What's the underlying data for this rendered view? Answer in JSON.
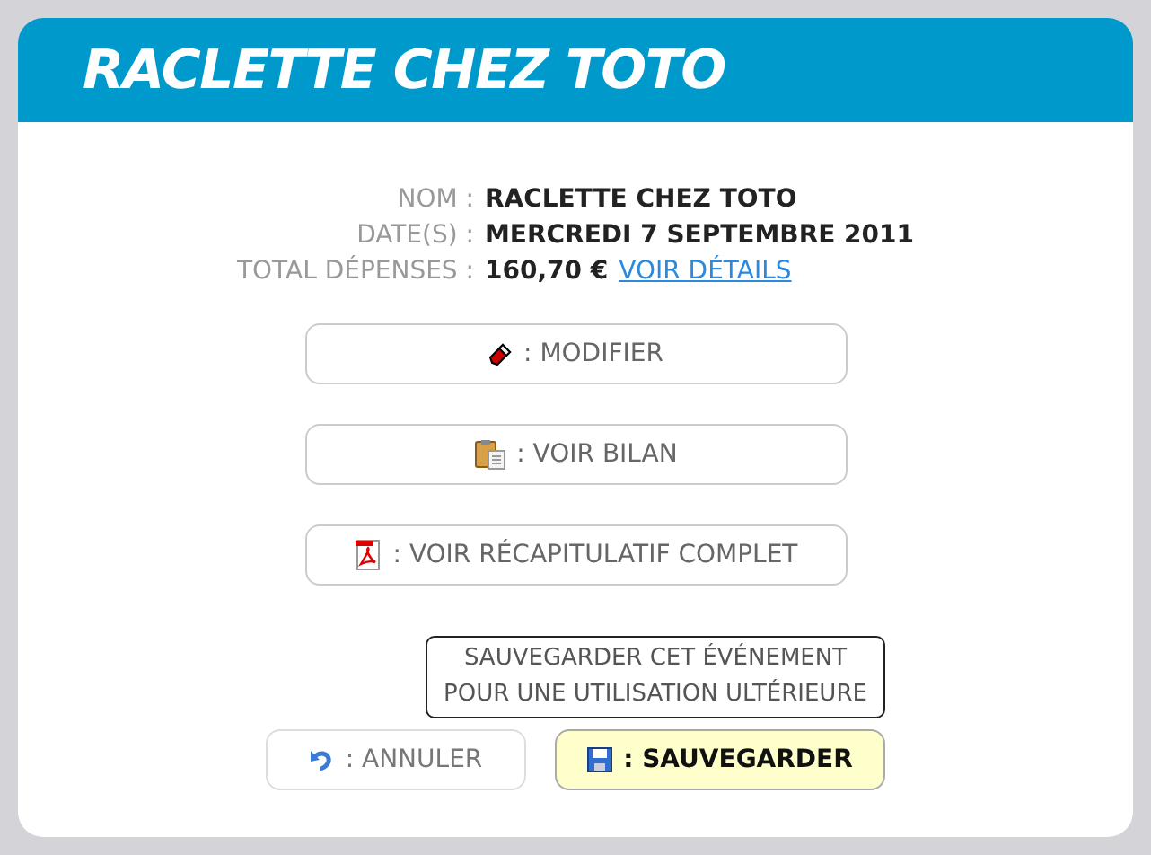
{
  "header": {
    "title": "RACLETTE CHEZ TOTO"
  },
  "details": [
    {
      "label": "NOM :",
      "value": "RACLETTE CHEZ TOTO"
    },
    {
      "label": "DATE(S) :",
      "value": "MERCREDI 7 SEPTEMBRE 2011"
    },
    {
      "label": "TOTAL DÉPENSES :",
      "value": "160,70 €",
      "link": "VOIR DÉTAILS"
    }
  ],
  "actions": [
    {
      "label": ": MODIFIER",
      "kind": "pencil"
    },
    {
      "label": ": VOIR BILAN",
      "kind": "clipboard"
    },
    {
      "label": ": VOIR RÉCAPITULATIF COMPLET",
      "kind": "pdf"
    }
  ],
  "tooltip": "SAUVEGARDER CET ÉVÉNEMENT POUR UNE UTILISATION ULTÉRIEURE",
  "footer": [
    {
      "label": ": ANNULER",
      "kind": "undo",
      "highlighted": false
    },
    {
      "label": ": SAUVEGARDER",
      "kind": "save",
      "highlighted": true
    }
  ]
}
